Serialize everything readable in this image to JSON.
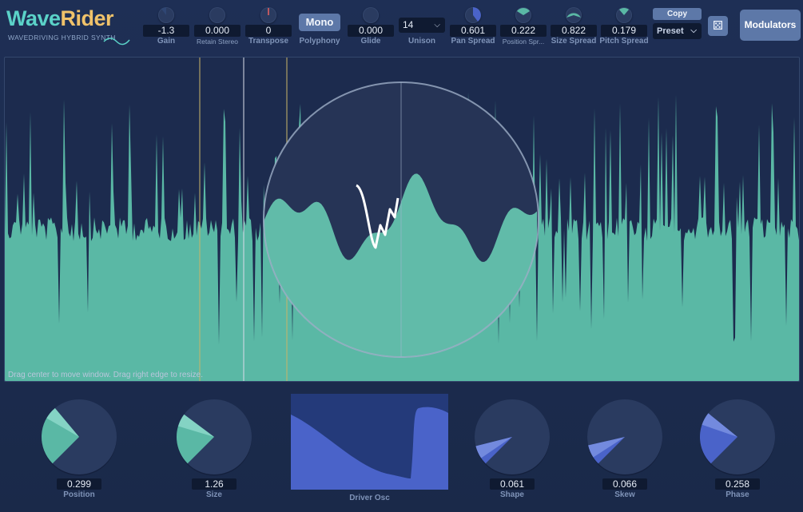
{
  "app": {
    "logo_wave": "Wave",
    "logo_rider": "Rider",
    "tagline": "WAVEDRIVING HYBRID SYNTH"
  },
  "header": {
    "gain": {
      "value": "-1.3",
      "label": "Gain"
    },
    "retain_stereo": {
      "value": "0.000",
      "label": "Retain Stereo"
    },
    "transpose": {
      "value": "0",
      "label": "Transpose"
    },
    "polyphony": {
      "button": "Mono",
      "label": "Polyphony"
    },
    "glide": {
      "value": "0.000",
      "label": "Glide"
    },
    "unison": {
      "value": "14",
      "label": "Unison"
    },
    "pan_spread": {
      "value": "0.601",
      "label": "Pan Spread"
    },
    "position_spread": {
      "value": "0.222",
      "label": "Position Spr..."
    },
    "size_spread": {
      "value": "0.822",
      "label": "Size Spread"
    },
    "pitch_spread": {
      "value": "0.179",
      "label": "Pitch Spread"
    },
    "copy_label": "Copy",
    "preset_label": "Preset",
    "modulators_label": "Modulators"
  },
  "waveform": {
    "hint": "Drag center to move window. Drag right edge to resize.",
    "color": "#5ab8a5"
  },
  "bottom": {
    "position": {
      "value": "0.299",
      "label": "Position",
      "level": 0.299
    },
    "size": {
      "value": "1.26",
      "label": "Size",
      "level": 0.25
    },
    "driver_osc": {
      "label": "Driver Osc"
    },
    "shape": {
      "value": "0.061",
      "label": "Shape",
      "level": 0.061
    },
    "skew": {
      "value": "0.066",
      "label": "Skew",
      "level": 0.066
    },
    "phase": {
      "value": "0.258",
      "label": "Phase",
      "level": 0.258
    }
  },
  "colors": {
    "accent": "#5d78a8",
    "teal": "#5ab8a5",
    "blue_fill": "#4a63c9",
    "background": "#1b2a4c"
  }
}
